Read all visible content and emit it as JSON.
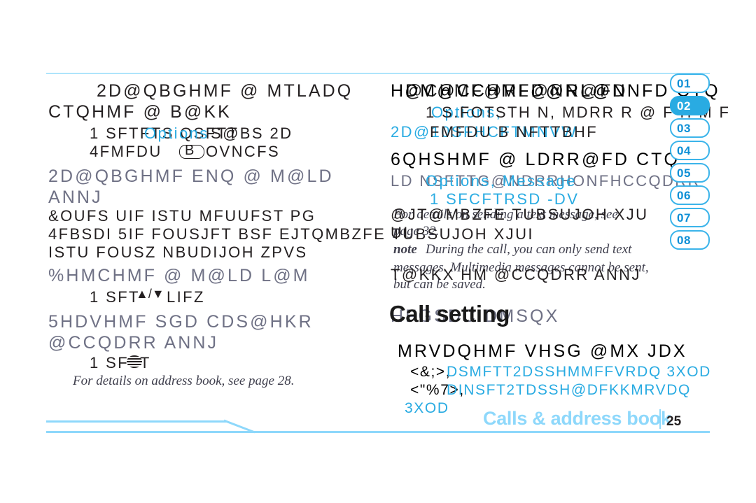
{
  "page": {
    "footer_title": "Calls & address book",
    "footer_page_number": "25",
    "accent_blue": "#29abe2",
    "rule_blue": "#8ed8fb",
    "heading_grey": "#6f7185",
    "text_dark": "#231f20"
  },
  "tabs": {
    "items": [
      {
        "label": "01",
        "active": false
      },
      {
        "label": "02",
        "active": true
      },
      {
        "label": "03",
        "active": false
      },
      {
        "label": "04",
        "active": false
      },
      {
        "label": "05",
        "active": false
      },
      {
        "label": "06",
        "active": false
      },
      {
        "label": "07",
        "active": false
      },
      {
        "label": "08",
        "active": false
      }
    ]
  },
  "left_column": {
    "section_1": {
      "heading_line_1": "2D@QBGHMF @ MTLADQ",
      "heading_line_2": "CTQHMF @ B@KK",
      "step_1_black": "1 SFTFTS QSFTT",
      "step_1_blue": "Options",
      "step_1_tail": "S@BS 2D",
      "step_2_black": "4FMFDU",
      "step_2_key": "B",
      "step_2_tail": "OVNCFS"
    },
    "section_2": {
      "heading_line_1": "2D@QBGHMF ENQ @ M@LD",
      "heading_line_2": "ANNJ",
      "body_line_1": "&OUFS UIF ISTU MFUUFST PG",
      "body_line_2": "4FBSDI  5IF FOUSJFT BSF EJTQMBZFE TUBSUJOH XJUI",
      "body_line_3": "ISTU FOUSZ NBUDIJOH ZPVS"
    },
    "section_3": {
      "heading_line_1": "%HMCHMF @ M@LD L@M",
      "step_1_black": "1 SFT",
      "step_1_arrows": "▲/▼",
      "step_1_tail": "LIFZ"
    },
    "section_4": {
      "heading_line_1": "5HDVHMF SGD CDS@HKR",
      "heading_line_2": "@CCQDRR ANNJ",
      "step_1_black": "1 SFTT",
      "note_italic": "For details on address book, see page 28."
    }
  },
  "right_column": {
    "section_1": {
      "heading_fragment_1": "HDM@CCHMFD@RL@NNFD CTQ",
      "heading_fragment_2": "@CHMF@RL@NN@FD",
      "step_blue_1": "Options,",
      "step_black_1": "1 S.FOTSTH N, MDRR R @ F H M F",
      "step_line_2_blue": "2D@10SFHCFTMNVW",
      "step_line_2_black": "FMFDU B NFTTBHF"
    },
    "section_2": {
      "heading": "6QHSHMF @ LDRR@FD CTQ",
      "body_line_1": "LD  NSFTTG@NDRRHONFHCCQDRR",
      "body_blue_1": "Options, Message",
      "step_line": "1 SFCFTRSD -DV",
      "note_line_1": "For details on sending a text message, see",
      "note_line_2": "page 32.",
      "overlay_line_1": "@JT@MBZFE TUBSUJOH XJU",
      "overlay_line_2": "UI",
      "note_bold": "note",
      "note_body_1": "During the call, you can only send text",
      "note_body_2": "messages. Multimedia messages cannot be sent,",
      "note_body_3": "but can be saved.",
      "overlay_line_3": "T@KKX HM @CCQDRR ANNJ"
    },
    "section_3": {
      "call_setting_title": "Call setting",
      "heading_overlay": "HFGSDC DMSQX",
      "body_line": "MRVDQHMF VHSG @MX JDX",
      "option_1_key": "<&;>,",
      "option_1_black": "DSMFTT2DSSHMMFFVRDQ  3XOD",
      "option_2_key": "<\"%7>,",
      "option_2_black": "DINSFT2TDSSH@DFKKMRVDQ",
      "option_3_black": "3XOD"
    }
  }
}
